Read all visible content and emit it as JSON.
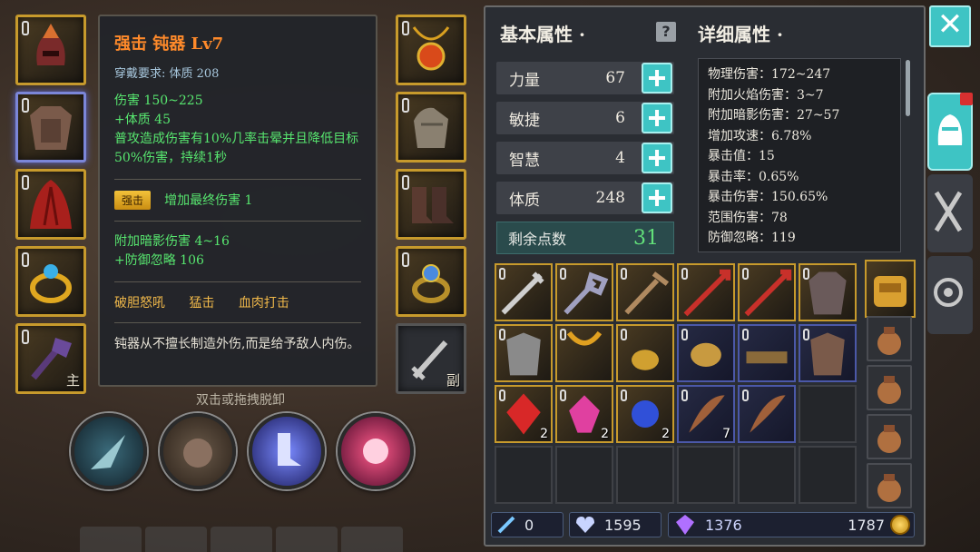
{
  "equipment": {
    "left_slots": [
      {
        "name": "helmet"
      },
      {
        "name": "armor"
      },
      {
        "name": "cloak"
      },
      {
        "name": "ring"
      },
      {
        "name": "main-weapon",
        "tag": "主"
      }
    ],
    "right_slots": [
      {
        "name": "necklace"
      },
      {
        "name": "gloves"
      },
      {
        "name": "boots"
      },
      {
        "name": "ring"
      },
      {
        "name": "sub-weapon",
        "tag": "副"
      }
    ]
  },
  "tooltip": {
    "title": "强击  钝器  Lv7",
    "requirement": "穿戴要求:   体质 208",
    "stats": [
      "伤害   150~225",
      "+体质  45",
      "普攻造成伤害有10%几率击晕并且降低目标50%伤害，持续1秒"
    ],
    "badge_label": "强击",
    "badge_text": "增加最终伤害 1",
    "bonus": [
      "附加暗影伤害  4~16",
      "+防御忽略  106"
    ],
    "skills": [
      "破胆怒吼",
      "猛击",
      "血肉打击"
    ],
    "description": "钝器从不擅长制造外伤,而是给予敌人内伤。"
  },
  "hint": "双击或拖拽脱卸",
  "basic_attributes": {
    "title": "基本属性 ·",
    "stats": [
      {
        "label": "力量",
        "value": "67"
      },
      {
        "label": "敏捷",
        "value": "6"
      },
      {
        "label": "智慧",
        "value": "4"
      },
      {
        "label": "体质",
        "value": "248"
      }
    ],
    "remaining_label": "剩余点数",
    "remaining_value": "31"
  },
  "detail_attributes": {
    "title": "详细属性 ·",
    "lines": [
      "物理伤害：172~247",
      "附加火焰伤害：3~7",
      "附加暗影伤害：27~57",
      "增加攻速：6.78%",
      "暴击值：15",
      "暴击率：0.65%",
      "暴击伤害：150.65%",
      "范围伤害：78",
      "防御忽略：119"
    ]
  },
  "inventory": [
    {
      "type": "gold",
      "icon": "greatsword-icon"
    },
    {
      "type": "gold",
      "icon": "mace-icon"
    },
    {
      "type": "gold",
      "icon": "spiked-mace-icon"
    },
    {
      "type": "gold",
      "icon": "red-spear-icon"
    },
    {
      "type": "gold",
      "icon": "red-spear-icon"
    },
    {
      "type": "gold",
      "icon": "leather-armor-icon"
    },
    {
      "type": "gold",
      "icon": "iron-armor-icon"
    },
    {
      "type": "gold",
      "icon": "amulet-icon"
    },
    {
      "type": "gold",
      "icon": "ring-icon"
    },
    {
      "type": "blue",
      "icon": "bracelet-icon"
    },
    {
      "type": "blue",
      "icon": "belt-icon"
    },
    {
      "type": "blue",
      "icon": "armor-icon"
    },
    {
      "type": "gold",
      "icon": "red-gem-icon",
      "count": "2"
    },
    {
      "type": "gold",
      "icon": "pink-gem-icon",
      "count": "2"
    },
    {
      "type": "gold",
      "icon": "blue-gem-icon",
      "count": "2"
    },
    {
      "type": "blue",
      "icon": "feather-icon",
      "count": "7"
    },
    {
      "type": "blue",
      "icon": "feather-icon"
    },
    {
      "type": "empty"
    },
    {
      "type": "empty"
    },
    {
      "type": "empty"
    },
    {
      "type": "empty"
    },
    {
      "type": "empty"
    },
    {
      "type": "empty"
    },
    {
      "type": "empty"
    }
  ],
  "currency": {
    "keys": "0",
    "gems": "1595",
    "crystals": "1376",
    "gold": "1787"
  },
  "colors": {
    "accent": "#3ec4c4",
    "gold_border": "#c79a2c",
    "green_text": "#57e66f",
    "orange_title": "#ff8a2a"
  }
}
